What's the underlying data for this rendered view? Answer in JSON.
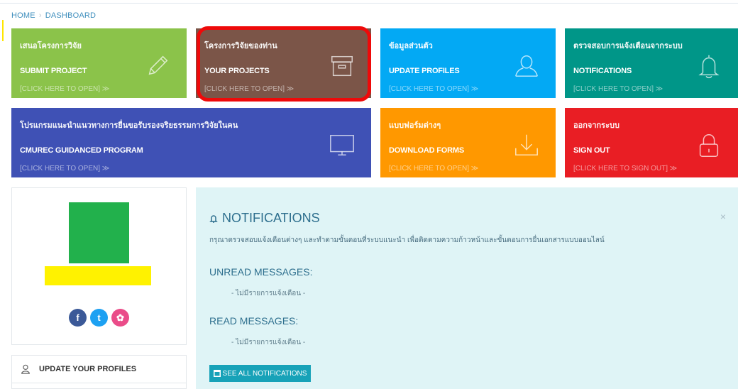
{
  "breadcrumb": {
    "home": "HOME",
    "current": "DASHBOARD"
  },
  "tiles": [
    {
      "thai": "เสนอโครงการวิจัย",
      "en": "SUBMIT PROJECT",
      "link": "[CLICK HERE TO OPEN] ≫",
      "color": "#8bc34a",
      "icon": "pencil-icon"
    },
    {
      "thai": "โครงการวิจัยของท่าน",
      "en": "YOUR PROJECTS",
      "link": "[CLICK HERE TO OPEN] ≫",
      "color": "#7b5548",
      "icon": "archive-box-icon"
    },
    {
      "thai": "ข้อมูลส่วนตัว",
      "en": "UPDATE PROFILES",
      "link": "[CLICK HERE TO OPEN] ≫",
      "color": "#03a9f4",
      "icon": "user-icon"
    },
    {
      "thai": "ตรวจสอบการแจ้งเตือนจากระบบ",
      "en": "NOTIFICATIONS",
      "link": "[CLICK HERE TO OPEN] ≫",
      "color": "#009688",
      "icon": "bell-icon"
    },
    {
      "thai": "โปรแกรมแนะนำแนวทางการยื่นขอรับรองจริยธรรมการวิจัยในคน",
      "en": "CMUREC GUIDANCED PROGRAM",
      "link": "[CLICK HERE TO OPEN] ≫",
      "color": "#3f51b5",
      "icon": "monitor-icon"
    },
    {
      "thai": "แบบฟอร์มต่างๆ",
      "en": "DOWNLOAD FORMS",
      "link": "[CLICK HERE TO OPEN] ≫",
      "color": "#ff9800",
      "icon": "download-icon"
    },
    {
      "thai": "ออกจากระบบ",
      "en": "SIGN OUT",
      "link": "[CLICK HERE TO SIGN OUT] ≫",
      "color": "#e91e24",
      "icon": "lock-icon"
    }
  ],
  "social": [
    {
      "label": "f",
      "icon": "facebook-icon",
      "color": "#3b5998"
    },
    {
      "label": "t",
      "icon": "twitter-icon",
      "color": "#1da1f2"
    },
    {
      "label": "✿",
      "icon": "dribbble-icon",
      "color": "#ea4c89"
    }
  ],
  "side_menu": {
    "update_profiles": "UPDATE YOUR PROFILES"
  },
  "notifications": {
    "title": "NOTIFICATIONS",
    "description": "กรุณาตรวจสอบแจ้งเตือนต่างๆ และทำตามขั้นตอนที่ระบบแนะนำ เพื่อติดตามความก้าวหน้าและขั้นตอนการยื่นเอกสารแบบออนไลน์",
    "close": "×",
    "unread_heading": "UNREAD MESSAGES:",
    "unread_empty": "- ไม่มีรายการแจ้งเตือน -",
    "read_heading": "READ MESSAGES:",
    "read_empty": "- ไม่มีรายการแจ้งเตือน -",
    "see_all": "SEE ALL NOTIFICATIONS"
  },
  "colors": {
    "link": "#3c8dbc",
    "panel_bg": "#dff4f6",
    "button": "#17a2b8",
    "highlight": "#ee0a0a"
  }
}
